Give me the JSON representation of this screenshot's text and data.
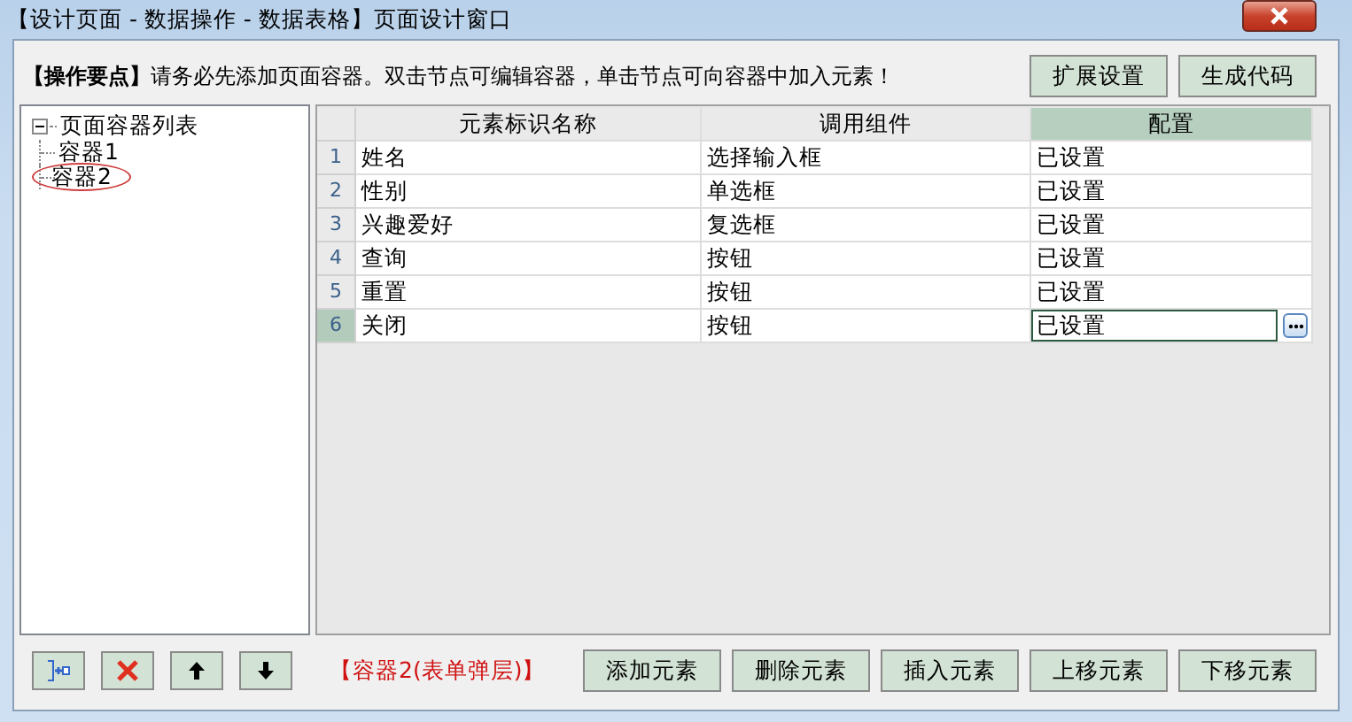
{
  "window": {
    "title": "【设计页面 - 数据操作 - 数据表格】页面设计窗口"
  },
  "hint": {
    "label": "【操作要点】",
    "text": "请务必先添加页面容器。双击节点可编辑容器，单击节点可向容器中加入元素！"
  },
  "top_buttons": [
    "扩展设置",
    "生成代码"
  ],
  "tree": {
    "label": "页面容器列表",
    "expanded": true,
    "children": [
      {
        "label": "容器1",
        "selected": false
      },
      {
        "label": "容器2",
        "selected": true
      }
    ]
  },
  "table": {
    "columns": [
      {
        "label": "元素标识名称",
        "selected": false
      },
      {
        "label": "调用组件",
        "selected": false
      },
      {
        "label": "配置",
        "selected": true
      }
    ],
    "rows": [
      {
        "index": "1",
        "cells": [
          "姓名",
          "选择输入框",
          "已设置"
        ],
        "selected": false
      },
      {
        "index": "2",
        "cells": [
          "性别",
          "单选框",
          "已设置"
        ],
        "selected": false
      },
      {
        "index": "3",
        "cells": [
          "兴趣爱好",
          "复选框",
          "已设置"
        ],
        "selected": false
      },
      {
        "index": "4",
        "cells": [
          "查询",
          "按钮",
          "已设置"
        ],
        "selected": false
      },
      {
        "index": "5",
        "cells": [
          "重置",
          "按钮",
          "已设置"
        ],
        "selected": false
      },
      {
        "index": "6",
        "cells": [
          "关闭",
          "按钮",
          "已设置"
        ],
        "selected": true
      }
    ]
  },
  "tool_buttons": [
    {
      "kind": "add-node"
    },
    {
      "kind": "delete"
    },
    {
      "kind": "up"
    },
    {
      "kind": "down"
    }
  ],
  "current_container": "【容器2(表单弹层)】",
  "bottom_buttons": [
    "添加元素",
    "删除元素",
    "插入元素",
    "上移元素",
    "下移元素"
  ]
}
